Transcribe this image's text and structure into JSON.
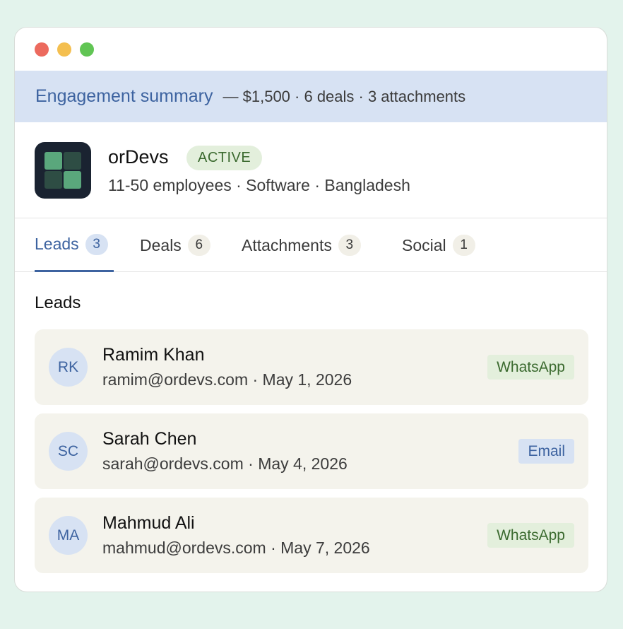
{
  "banner": {
    "title": "Engagement summary",
    "meta": "— $1,500 · 6 deals · 3 attachments"
  },
  "company": {
    "name": "orDevs",
    "status": "ACTIVE",
    "meta": "11-50 employees · Software · Bangladesh",
    "logo_icon": "grid-logo-icon"
  },
  "tabs": [
    {
      "label": "Leads",
      "count": "3",
      "active": true
    },
    {
      "label": "Deals",
      "count": "6",
      "active": false
    },
    {
      "label": "Attachments",
      "count": "3",
      "active": false
    },
    {
      "label": "Social",
      "count": "1",
      "active": false
    }
  ],
  "section_title": "Leads",
  "leads": [
    {
      "initials": "RK",
      "name": "Ramim Khan",
      "meta": "ramim@ordevs.com · May 1, 2026",
      "channel": "WhatsApp"
    },
    {
      "initials": "SC",
      "name": "Sarah Chen",
      "meta": "sarah@ordevs.com · May 4, 2026",
      "channel": "Email"
    },
    {
      "initials": "MA",
      "name": "Mahmud Ali",
      "meta": "mahmud@ordevs.com · May 7, 2026",
      "channel": "WhatsApp"
    }
  ],
  "colors": {
    "accent": "#3d63a0",
    "banner_bg": "#d7e2f3",
    "active_badge_bg": "#e3efdc",
    "active_badge_text": "#3b6a2f",
    "card_bg": "#f4f3ec",
    "page_bg": "#e3f3ec"
  }
}
